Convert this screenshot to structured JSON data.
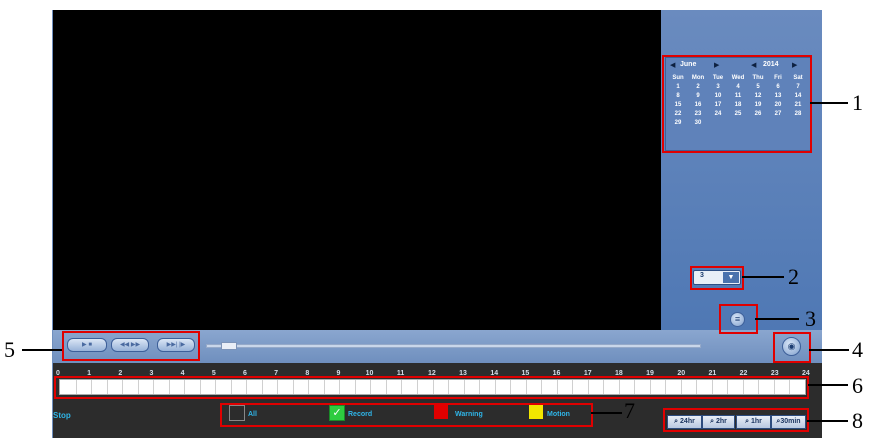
{
  "calendar": {
    "month": "June",
    "year": "2014",
    "weekdays": [
      "Sun",
      "Mon",
      "Tue",
      "Wed",
      "Thu",
      "Fri",
      "Sat"
    ],
    "days": [
      "1",
      "2",
      "3",
      "4",
      "5",
      "6",
      "7",
      "8",
      "9",
      "10",
      "11",
      "12",
      "13",
      "14",
      "15",
      "16",
      "17",
      "18",
      "19",
      "20",
      "21",
      "22",
      "23",
      "24",
      "25",
      "26",
      "27",
      "28",
      "29",
      "30"
    ]
  },
  "channel_select": {
    "value": "3",
    "arrow_icon": "triangle-down-icon"
  },
  "playback_controls": {
    "play_stop": "▶ ■",
    "rewind_forward": "◀◀ ▶▶",
    "frame_step": "▶▶| |▶"
  },
  "timeline": {
    "hours": [
      "0",
      "1",
      "2",
      "3",
      "4",
      "5",
      "6",
      "7",
      "8",
      "9",
      "10",
      "11",
      "12",
      "13",
      "14",
      "15",
      "16",
      "17",
      "18",
      "19",
      "20",
      "21",
      "22",
      "23",
      "24"
    ]
  },
  "status": {
    "label": "Stop"
  },
  "legend": [
    {
      "label": "All",
      "color": "#ffffff",
      "checked": false
    },
    {
      "label": "Record",
      "color": "#2ecc40",
      "checked": true
    },
    {
      "label": "Warning",
      "color": "#e00000",
      "checked": false
    },
    {
      "label": "Motion",
      "color": "#f2e600",
      "checked": false
    }
  ],
  "zoom_buttons": [
    "24hr",
    "2hr",
    "1hr",
    "30min"
  ],
  "annotations": [
    "1",
    "2",
    "3",
    "4",
    "5",
    "6",
    "7",
    "8"
  ]
}
